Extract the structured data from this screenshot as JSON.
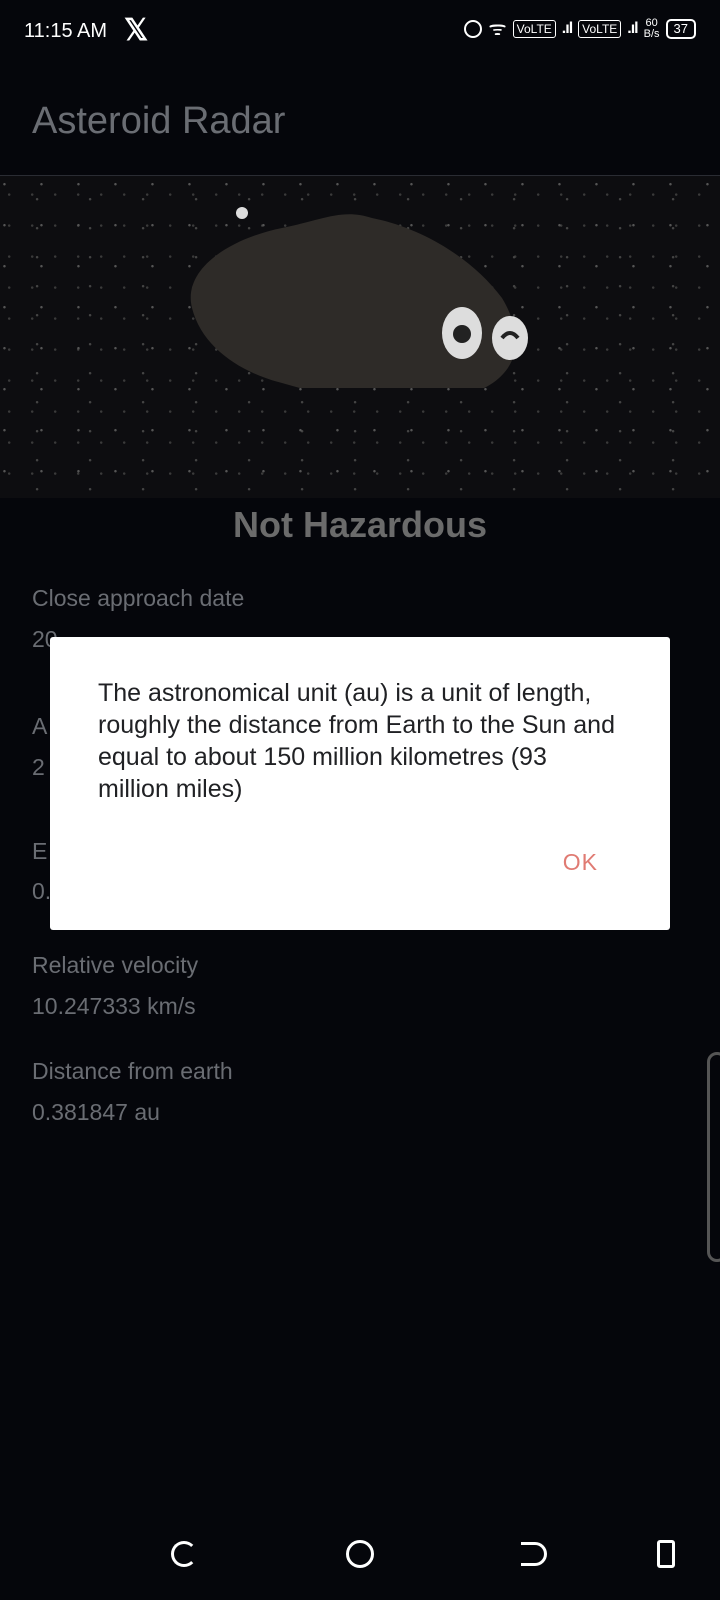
{
  "status_bar": {
    "time": "11:15 AM",
    "app_icon": "x-logo-icon",
    "volte1": "VoLTE",
    "volte2": "VoLTE",
    "speed_top": "60",
    "speed_bottom": "B/s",
    "battery": "37"
  },
  "app_bar": {
    "title": "Asteroid Radar"
  },
  "hero": {
    "status_text": "Not Hazardous"
  },
  "details": [
    {
      "label": "Close approach date",
      "value": "20"
    },
    {
      "label": "A",
      "value": "2"
    },
    {
      "label": "E",
      "value": "0."
    },
    {
      "label": "Relative velocity",
      "value": "10.247333 km/s"
    },
    {
      "label": "Distance from earth",
      "value": "0.381847 au"
    }
  ],
  "dialog": {
    "message": "The astronomical unit (au) is a unit of length, roughly the distance from Earth to the Sun and equal to about 150 million kilometres (93 million miles)",
    "ok_label": "OK"
  },
  "colors": {
    "background": "#05060b",
    "accent": "#e07b73",
    "muted_text": "#6a6d73"
  }
}
